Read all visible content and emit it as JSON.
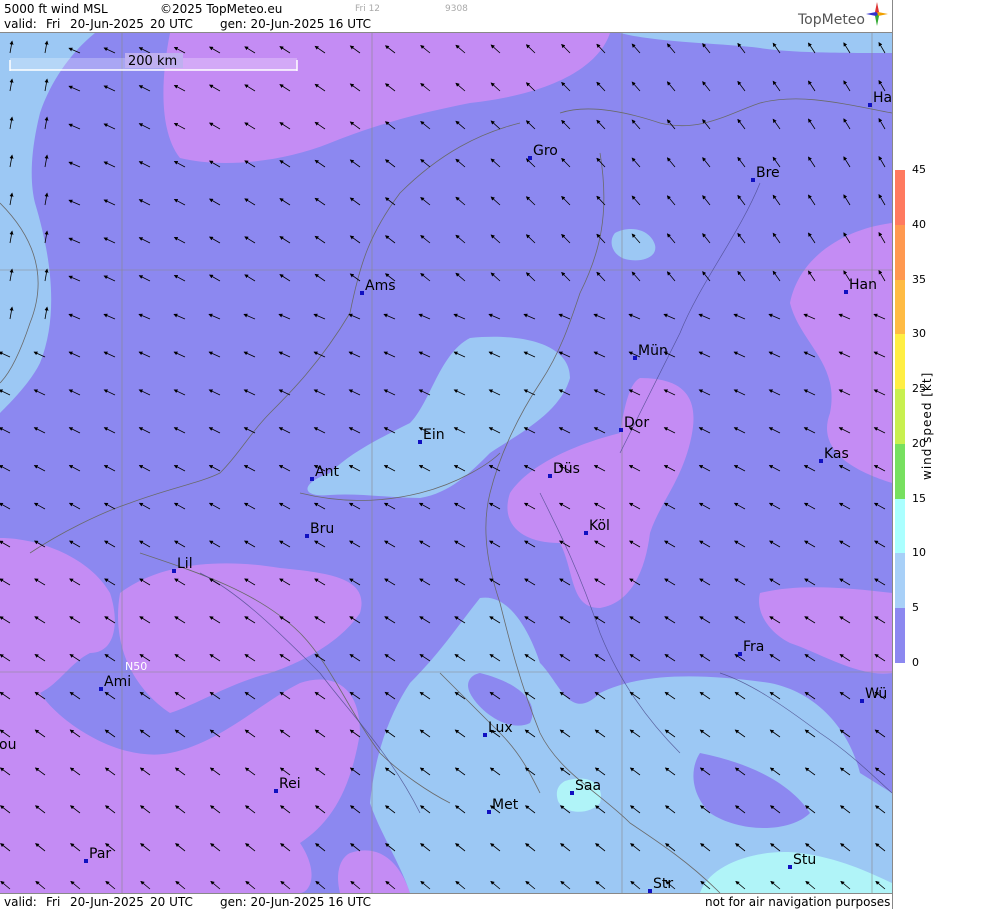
{
  "header": {
    "product": "5000 ft wind MSL",
    "copyright": "©2025 TopMeteo.eu",
    "valid_label": "valid:",
    "valid_day": "Fri",
    "valid_date": "20-Jun-2025",
    "valid_time": "20 UTC",
    "gen": "gen: 20-Jun-2025 16 UTC",
    "faint_day": "Fri 12",
    "faint_code": "9308",
    "logo_text": "TopMeteo"
  },
  "footer": {
    "valid_label": "valid:",
    "valid_day": "Fri",
    "valid_date": "20-Jun-2025",
    "valid_time": "20 UTC",
    "gen": "gen: 20-Jun-2025 16 UTC",
    "disclaimer": "not for air navigation purposes"
  },
  "map": {
    "scale_label": "200 km",
    "lat_label": "N50",
    "cities": [
      {
        "name": "Ha"
      },
      {
        "name": "Gro"
      },
      {
        "name": "Bre"
      },
      {
        "name": "Ams"
      },
      {
        "name": "Han"
      },
      {
        "name": "Mün"
      },
      {
        "name": "Ein"
      },
      {
        "name": "Dor"
      },
      {
        "name": "Kas"
      },
      {
        "name": "Ant"
      },
      {
        "name": "Düs"
      },
      {
        "name": "Köl"
      },
      {
        "name": "Bru"
      },
      {
        "name": "Lil"
      },
      {
        "name": "Fra"
      },
      {
        "name": "Ami"
      },
      {
        "name": "Wü"
      },
      {
        "name": "Lux"
      },
      {
        "name": "ou"
      },
      {
        "name": "Rei"
      },
      {
        "name": "Saa"
      },
      {
        "name": "Met"
      },
      {
        "name": "Stu"
      },
      {
        "name": "Par"
      },
      {
        "name": "Str"
      }
    ]
  },
  "legend": {
    "title": "wind speed [kt]",
    "ticks": [
      "45",
      "40",
      "35",
      "30",
      "25",
      "20",
      "15",
      "10",
      "5",
      "0"
    ],
    "colors": [
      "#ff7a60",
      "#ff9950",
      "#ffbb44",
      "#ffee44",
      "#c8f050",
      "#77e060",
      "#aaffff",
      "#a8d0f8",
      "#8c88f0",
      "#c890f0"
    ]
  },
  "colors": {
    "violet": "#c48cf4",
    "blue_violet": "#8c88f0",
    "light_blue": "#9cc8f4",
    "cyan": "#b0f4f8"
  }
}
